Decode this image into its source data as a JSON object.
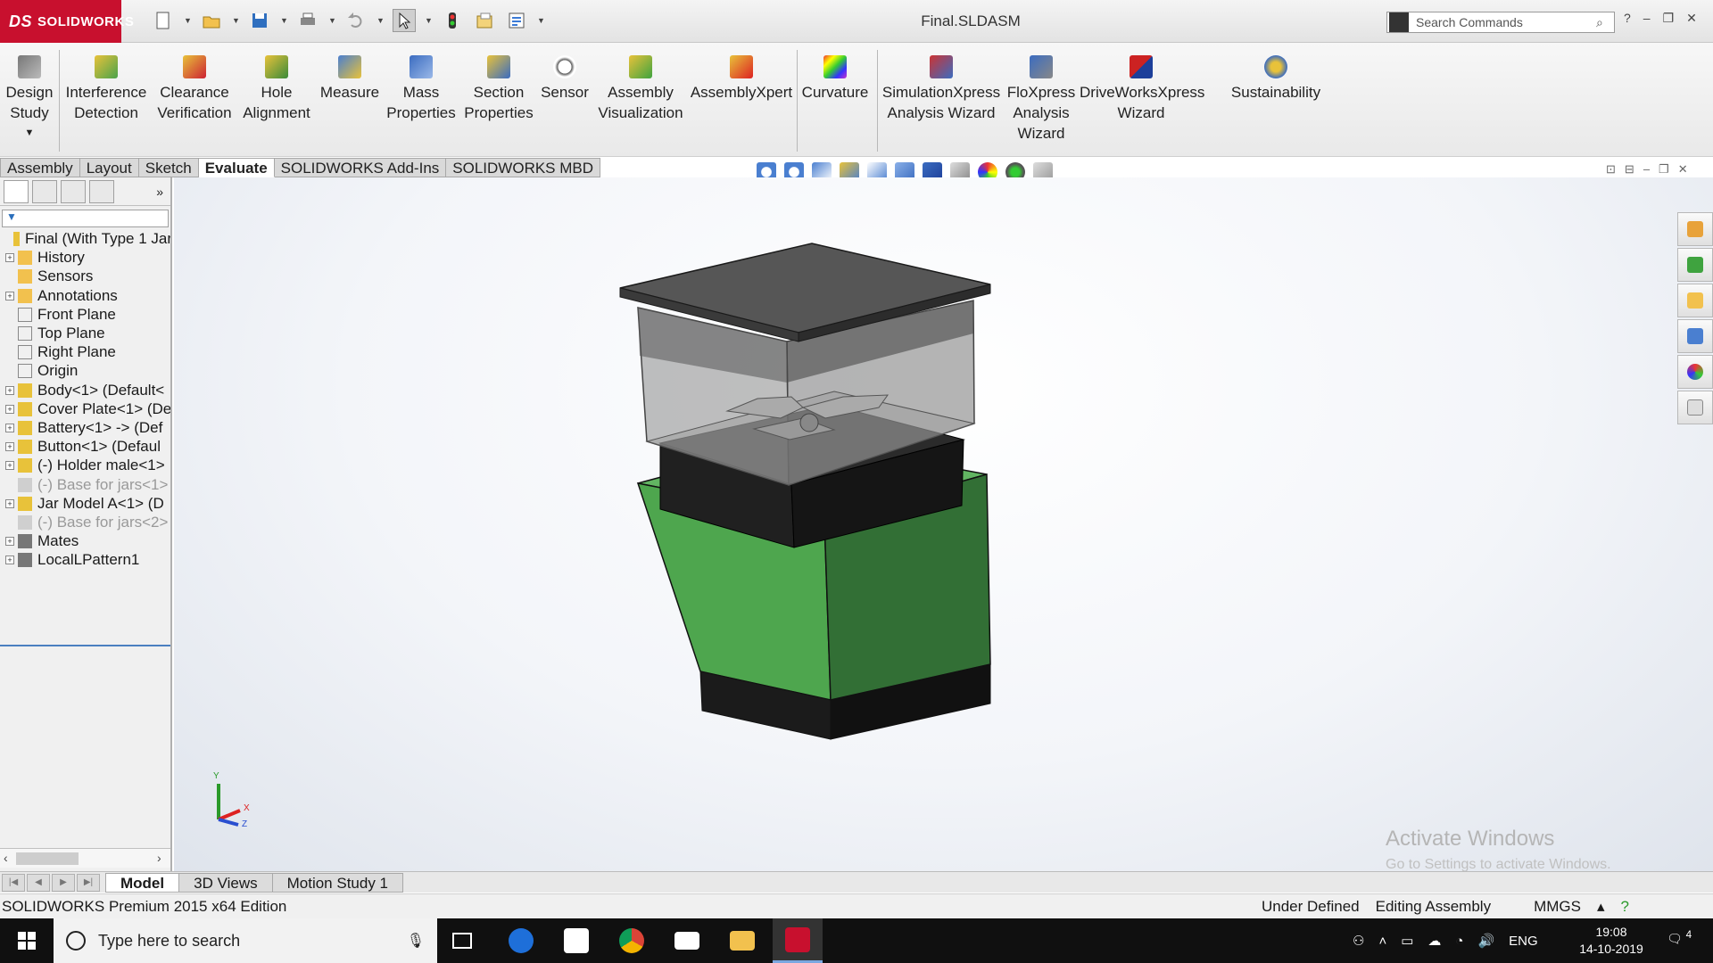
{
  "app": {
    "brand": "SOLIDWORKS",
    "document_title": "Final.SLDASM",
    "search_placeholder": "Search Commands"
  },
  "commands": [
    {
      "id": "design-study",
      "label1": "Design",
      "label2": "Study",
      "label3": ""
    },
    {
      "id": "interference-detection",
      "label1": "Interference",
      "label2": "Detection",
      "label3": ""
    },
    {
      "id": "clearance-verification",
      "label1": "Clearance",
      "label2": "Verification",
      "label3": ""
    },
    {
      "id": "hole-alignment",
      "label1": "Hole",
      "label2": "Alignment",
      "label3": ""
    },
    {
      "id": "measure",
      "label1": "Measure",
      "label2": "",
      "label3": ""
    },
    {
      "id": "mass-properties",
      "label1": "Mass",
      "label2": "Properties",
      "label3": ""
    },
    {
      "id": "section-properties",
      "label1": "Section",
      "label2": "Properties",
      "label3": ""
    },
    {
      "id": "sensor",
      "label1": "Sensor",
      "label2": "",
      "label3": ""
    },
    {
      "id": "assembly-visualization",
      "label1": "Assembly",
      "label2": "Visualization",
      "label3": ""
    },
    {
      "id": "assemblyxpert",
      "label1": "AssemblyXpert",
      "label2": "",
      "label3": ""
    },
    {
      "id": "curvature",
      "label1": "Curvature",
      "label2": "",
      "label3": ""
    },
    {
      "id": "simulationxpress",
      "label1": "SimulationXpress",
      "label2": "Analysis Wizard",
      "label3": ""
    },
    {
      "id": "floxpress",
      "label1": "FloXpress",
      "label2": "Analysis",
      "label3": "Wizard"
    },
    {
      "id": "driveworksxpress",
      "label1": "DriveWorksXpress",
      "label2": "Wizard",
      "label3": ""
    },
    {
      "id": "sustainability",
      "label1": "Sustainability",
      "label2": "",
      "label3": ""
    }
  ],
  "tabs": [
    "Assembly",
    "Layout",
    "Sketch",
    "Evaluate",
    "SOLIDWORKS Add-Ins",
    "SOLIDWORKS MBD"
  ],
  "active_tab": "Evaluate",
  "tree": [
    {
      "label": "Final  (With Type 1 Jar",
      "exp": false,
      "dim": false,
      "icon": "assembly-icon"
    },
    {
      "label": "History",
      "exp": true,
      "dim": false,
      "icon": "history-icon"
    },
    {
      "label": "Sensors",
      "exp": false,
      "dim": false,
      "icon": "sensor-icon"
    },
    {
      "label": "Annotations",
      "exp": true,
      "dim": false,
      "icon": "annotation-icon"
    },
    {
      "label": "Front Plane",
      "exp": false,
      "dim": false,
      "icon": "plane-icon"
    },
    {
      "label": "Top Plane",
      "exp": false,
      "dim": false,
      "icon": "plane-icon"
    },
    {
      "label": "Right Plane",
      "exp": false,
      "dim": false,
      "icon": "plane-icon"
    },
    {
      "label": "Origin",
      "exp": false,
      "dim": false,
      "icon": "origin-icon"
    },
    {
      "label": "Body<1> (Default<",
      "exp": true,
      "dim": false,
      "icon": "part-icon"
    },
    {
      "label": "Cover Plate<1> (De",
      "exp": true,
      "dim": false,
      "icon": "part-icon"
    },
    {
      "label": "Battery<1> -> (Def",
      "exp": true,
      "dim": false,
      "icon": "part-icon"
    },
    {
      "label": "Button<1> (Defaul",
      "exp": true,
      "dim": false,
      "icon": "part-icon"
    },
    {
      "label": "(-) Holder male<1>",
      "exp": true,
      "dim": false,
      "icon": "part-icon"
    },
    {
      "label": "(-) Base for jars<1>",
      "exp": false,
      "dim": true,
      "icon": "part-suppressed-icon"
    },
    {
      "label": "Jar Model A<1> (D",
      "exp": true,
      "dim": false,
      "icon": "part-icon"
    },
    {
      "label": "(-) Base for jars<2>",
      "exp": false,
      "dim": true,
      "icon": "part-suppressed-icon"
    },
    {
      "label": "Mates",
      "exp": true,
      "dim": false,
      "icon": "mates-icon"
    },
    {
      "label": "LocalLPattern1",
      "exp": true,
      "dim": false,
      "icon": "pattern-icon"
    }
  ],
  "bottom_tabs": [
    "Model",
    "3D Views",
    "Motion Study 1"
  ],
  "active_bottom_tab": "Model",
  "status": {
    "edition": "SOLIDWORKS Premium 2015 x64 Edition",
    "definition": "Under Defined",
    "mode": "Editing Assembly",
    "units": "MMGS"
  },
  "watermark": {
    "title": "Activate Windows",
    "subtitle": "Go to Settings to activate Windows."
  },
  "triad": {
    "x": "X",
    "y": "Y",
    "z": "Z"
  },
  "taskbar": {
    "search_placeholder": "Type here to search",
    "language": "ENG",
    "time": "19:08",
    "date": "14-10-2019",
    "notifications": "4"
  },
  "colors": {
    "brand_red": "#c8102e",
    "base_green": "#4ea64e",
    "jar_dark": "#1f1f1f",
    "lid_gray": "#545454"
  }
}
